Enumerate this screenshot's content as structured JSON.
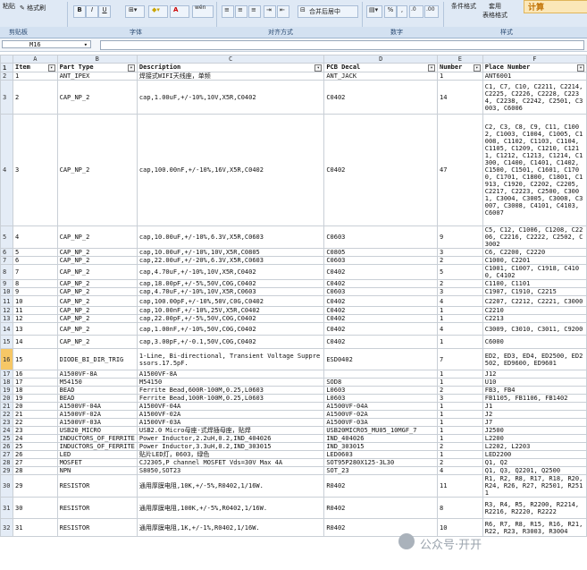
{
  "ribbon": {
    "paste": "粘贴",
    "format_painter": "格式刷",
    "bold": "B",
    "italic": "I",
    "underline": "U",
    "font_grow": "A",
    "wen": "wén",
    "merge_center": "合并后居中",
    "percent": "%",
    "comma": ",",
    "cond_format": "条件格式",
    "apply_table": "套用",
    "table_format": "表格格式",
    "calc": "计算",
    "groups": {
      "clipboard": "剪贴板",
      "font": "字体",
      "alignment": "对齐方式",
      "number": "数字",
      "styles": "样式"
    }
  },
  "formula_bar": {
    "name_box": "M16",
    "fx": ""
  },
  "columns": [
    "A",
    "B",
    "C",
    "D",
    "E",
    "F"
  ],
  "header_row": {
    "item": "Item",
    "part_type": "Part Type",
    "description": "Description",
    "pcb_decal": "PCB Decal",
    "number": "Number",
    "place_number": "Place Number"
  },
  "rows": [
    {
      "r": "2",
      "item": "1",
      "part": "ANT_IPEX",
      "desc": "焊接式WIFI天线座，单频",
      "decal": "ANT_JACK",
      "num": "1",
      "place": "ANT6001"
    },
    {
      "r": "3",
      "item": "2",
      "part": "CAP_NP_2",
      "desc": "cap,1.00uF,+/-10%,10V,X5R,C0402",
      "decal": "C0402",
      "num": "14",
      "place": "C1, C7, C10, C2211, C2214, C2225, C2226, C2228, C2234, C2238, C2242, C2501, C3003, C6006"
    },
    {
      "r": "4",
      "item": "3",
      "part": "CAP_NP_2",
      "desc": "cap,100.00nF,+/-10%,16V,X5R,C0402",
      "decal": "C0402",
      "num": "47",
      "place": "C2, C3, C8, C9, C11, C1002, C1003, C1004, C1005, C1008, C1102, C1103, C1104, C1105, C1209, C1210, C1211, C1212, C1213, C1214, C1300, C1400, C1401, C1402, C1500, C1501, C1601, C1700, C1701, C1800, C1801, C1913, C1920, C2202, C2205, C2217, C2223, C2500, C3001, C3004, C3005, C3008, C3007, C3008, C4101, C4103, C6007"
    },
    {
      "r": "5",
      "item": "4",
      "part": "CAP_NP_2",
      "desc": "cap,10.00uF,+/-10%,6.3V,X5R,C0603",
      "decal": "C0603",
      "num": "9",
      "place": "C5, C12, C1006, C1208, C2206, C2216, C2222, C2502, C3002"
    },
    {
      "r": "6",
      "item": "5",
      "part": "CAP_NP_2",
      "desc": "cap,10.00uF,+/-10%,10V,X5R,C0805",
      "decal": "C0805",
      "num": "3",
      "place": "C6, C2200, C2220"
    },
    {
      "r": "7",
      "item": "6",
      "part": "CAP_NP_2",
      "desc": "cap,22.00uF,+/-20%,6.3V,X5R,C0603",
      "decal": "C0603",
      "num": "2",
      "place": "C1000, C2201"
    },
    {
      "r": "8",
      "item": "7",
      "part": "CAP_NP_2",
      "desc": "cap,4.70uF,+/-10%,10V,X5R,C0402",
      "decal": "C0402",
      "num": "5",
      "place": "C1001, C1007, C1918, C4100, C4102"
    },
    {
      "r": "9",
      "item": "8",
      "part": "CAP_NP_2",
      "desc": "cap,18.00pF,+/-5%,50V,C0G,C0402",
      "decal": "C0402",
      "num": "2",
      "place": "C1100, C1101"
    },
    {
      "r": "10",
      "item": "9",
      "part": "CAP_NP_2",
      "desc": "cap,4.70uF,+/-10%,10V,X5R,C0603",
      "decal": "C0603",
      "num": "3",
      "place": "C1907, C1910, C2215"
    },
    {
      "r": "11",
      "item": "10",
      "part": "CAP_NP_2",
      "desc": "cap,100.00pF,+/-10%,50V,C0G,C0402",
      "decal": "C0402",
      "num": "4",
      "place": "C2207, C2212, C2221, C3000"
    },
    {
      "r": "12",
      "item": "11",
      "part": "CAP_NP_2",
      "desc": "cap,10.00nF,+/-10%,25V,X5R,C0402",
      "decal": "C0402",
      "num": "1",
      "place": "C2210"
    },
    {
      "r": "13",
      "item": "12",
      "part": "CAP_NP_2",
      "desc": "cap,22.00pF,+/-5%,50V,C0G,C0402",
      "decal": "C0402",
      "num": "1",
      "place": "C2213"
    },
    {
      "r": "14",
      "item": "13",
      "part": "CAP_NP_2",
      "desc": "cap,1.00nF,+/-10%,50V,C0G,C0402",
      "decal": "C0402",
      "num": "4",
      "place": "C3009, C3010, C3011, C9200"
    },
    {
      "r": "15",
      "item": "14",
      "part": "CAP_NP_2",
      "desc": "cap,3.00pF,+/-0.1,50V,C0G,C0402",
      "decal": "C0402",
      "num": "1",
      "place": "C6000"
    },
    {
      "r": "16",
      "item": "15",
      "part": "DIODE_BI_DIR_TRIG",
      "desc": "1-Line, Bi-directional, Transient Voltage Suppressors.17.5pF.",
      "decal": "ESD0402",
      "num": "7",
      "place": "ED2, ED3, ED4, ED2500, ED2502, ED9600, ED9601"
    },
    {
      "r": "17",
      "item": "16",
      "part": "A1500VF-8A",
      "desc": "A1500VF-8A",
      "decal": "",
      "num": "1",
      "place": "J12"
    },
    {
      "r": "18",
      "item": "17",
      "part": "M54150",
      "desc": "M54150",
      "decal": "SOD8",
      "num": "1",
      "place": "U10"
    },
    {
      "r": "19",
      "item": "18",
      "part": "BEAD",
      "desc": "Ferrite Bead,600R-100M,0.25,L0603",
      "decal": "L0603",
      "num": "2",
      "place": "FB3, FB4"
    },
    {
      "r": "20",
      "item": "19",
      "part": "BEAD",
      "desc": "Ferrite Bead,100R-100M,0.25,L0603",
      "decal": "L0603",
      "num": "3",
      "place": "FB1105, FB1106, FB1402"
    },
    {
      "r": "21",
      "item": "20",
      "part": "A1500VF-04A",
      "desc": "A1500VF-04A",
      "decal": "A1500VF-04A",
      "num": "1",
      "place": "J1"
    },
    {
      "r": "22",
      "item": "21",
      "part": "A1500VF-02A",
      "desc": "A1500VF-02A",
      "decal": "A1500VF-02A",
      "num": "1",
      "place": "J2"
    },
    {
      "r": "23",
      "item": "22",
      "part": "A1500VF-03A",
      "desc": "A1500VF-03A",
      "decal": "A1500VF-03A",
      "num": "1",
      "place": "J7"
    },
    {
      "r": "24",
      "item": "23",
      "part": "USB20_MICRO",
      "desc": "USB2.0 Micro母座-式焊插母座，贴焊",
      "decal": "USB20MICRO5_MU05_10MGF_7",
      "num": "1",
      "place": "J2500"
    },
    {
      "r": "25",
      "item": "24",
      "part": "INDUCTORS_OF_FERRITE",
      "desc": "Power Inductor,2.2uH,0.2,IND_404026",
      "decal": "IND_404026",
      "num": "1",
      "place": "L2200"
    },
    {
      "r": "26",
      "item": "25",
      "part": "INDUCTORS_OF_FERRITE",
      "desc": "Power Inductor,3.3uH,0.2,IND_303015",
      "decal": "IND_303015",
      "num": "2",
      "place": "L2202, L2203"
    },
    {
      "r": "27",
      "item": "26",
      "part": "LED",
      "desc": "贴片LED灯，0603，绿色",
      "decal": "LED0603",
      "num": "1",
      "place": "LED2200"
    },
    {
      "r": "28",
      "item": "27",
      "part": "MOSFET",
      "desc": "CJ2305,P channel MOSFET Vds=30V Max 4A",
      "decal": "SOT95P280X125-3L30",
      "num": "2",
      "place": "Q1, Q2"
    },
    {
      "r": "29",
      "item": "28",
      "part": "NPN",
      "desc": "S8050,SOT23",
      "decal": "SOT_23",
      "num": "4",
      "place": "Q1, Q3, Q2201, Q2500"
    },
    {
      "r": "30",
      "item": "29",
      "part": "RESISTOR",
      "desc": "通用厚膜电阻,10K,+/-5%,R0402,1/16W.",
      "decal": "R0402",
      "num": "11",
      "place": "R1, R2, R8, R17, R18, R20, R24, R26, R27, R2501, R2511"
    },
    {
      "r": "31",
      "item": "30",
      "part": "RESISTOR",
      "desc": "通用厚膜电阻,100K,+/-5%,R0402,1/16W.",
      "decal": "R0402",
      "num": "8",
      "place": "R3, R4, R5, R2200, R2214, R2216, R2220, R2222"
    },
    {
      "r": "32",
      "item": "31",
      "part": "RESISTOR",
      "desc": "通用厚膜电阻,1K,+/-1%,R0402,1/16W.",
      "decal": "R0402",
      "num": "10",
      "place": "R6, R7, R8, R15, R16, R21, R22, R23, R3003, R3004"
    }
  ],
  "watermark": "公众号·开开"
}
